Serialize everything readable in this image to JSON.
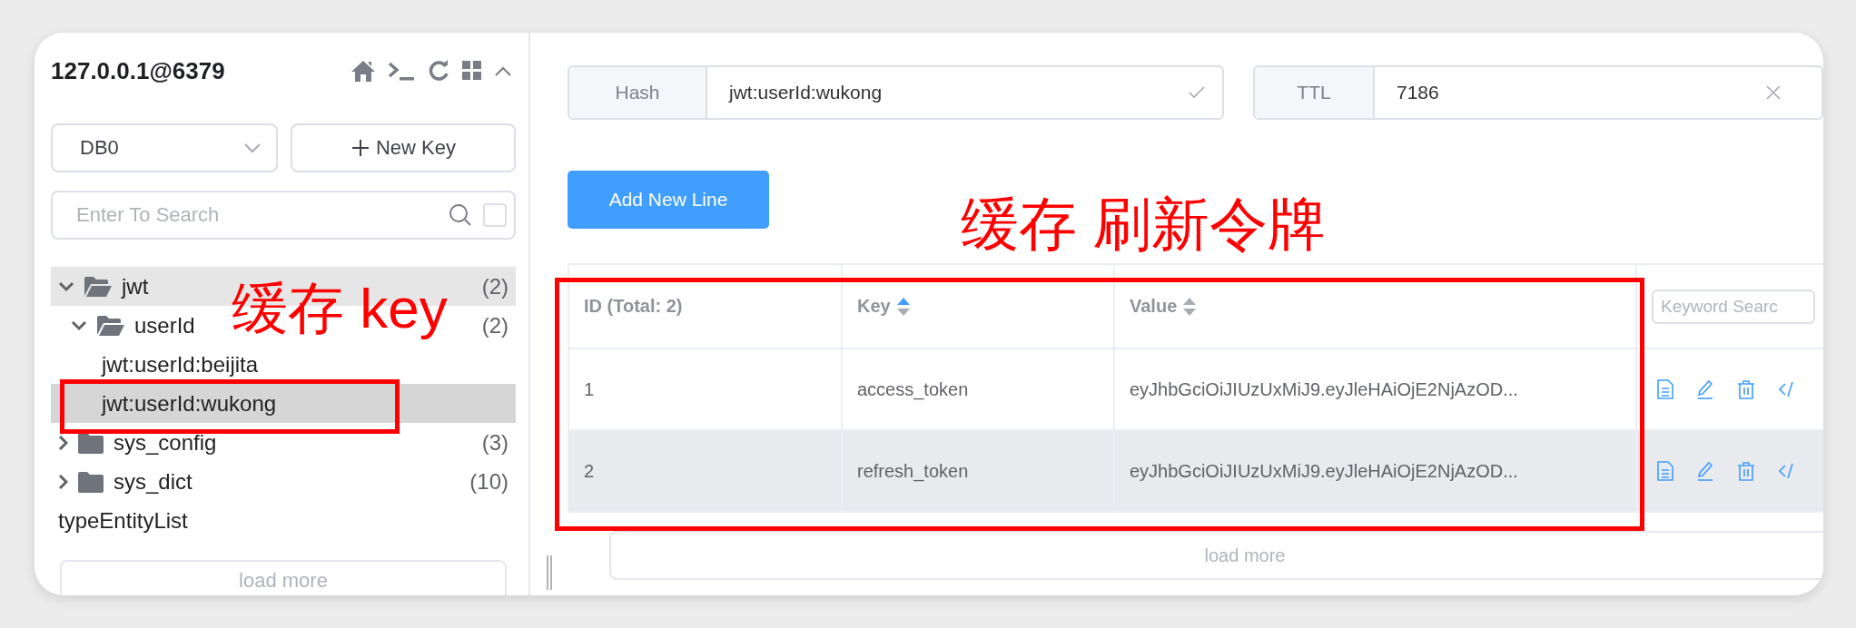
{
  "sidebar": {
    "connection": "127.0.0.1@6379",
    "db_select": {
      "value": "DB0"
    },
    "new_key_button": "New Key",
    "search": {
      "placeholder": "Enter To Search",
      "checked": false
    },
    "tree": [
      {
        "kind": "folder",
        "label": "jwt",
        "count": "(2)",
        "expanded": true,
        "highlighted": true,
        "selected": false,
        "children": [
          {
            "kind": "folder",
            "label": "userId",
            "count": "(2)",
            "expanded": true,
            "highlighted": false,
            "selected": false,
            "children": [
              {
                "kind": "key",
                "label": "jwt:userId:beijita",
                "highlighted": false,
                "selected": false
              },
              {
                "kind": "key",
                "label": "jwt:userId:wukong",
                "highlighted": false,
                "selected": true
              }
            ]
          }
        ]
      },
      {
        "kind": "folder",
        "label": "sys_config",
        "count": "(3)",
        "expanded": false,
        "highlighted": false,
        "selected": false
      },
      {
        "kind": "folder",
        "label": "sys_dict",
        "count": "(10)",
        "expanded": false,
        "highlighted": false,
        "selected": false
      },
      {
        "kind": "key",
        "label": "typeEntityList",
        "highlighted": false,
        "selected": false
      }
    ],
    "load_more": "load more"
  },
  "key_header": {
    "type": "Hash",
    "name": "jwt:userId:wukong",
    "ttl_label": "TTL",
    "ttl_value": "7186"
  },
  "add_button": "Add New Line",
  "table": {
    "columns": [
      {
        "kind": "text",
        "label": "ID (Total: 2)"
      },
      {
        "kind": "sortable",
        "label": "Key",
        "sorted": true
      },
      {
        "kind": "sortable",
        "label": "Value",
        "sorted": false
      },
      {
        "kind": "search",
        "placeholder": "Keyword Searc"
      }
    ],
    "rows": [
      {
        "id": "1",
        "key": "access_token",
        "value": "eyJhbGciOiJIUzUxMiJ9.eyJleHAiOjE2NjAzOD...",
        "highlighted": false
      },
      {
        "id": "2",
        "key": "refresh_token",
        "value": "eyJhbGciOiJIUzUxMiJ9.eyJleHAiOjE2NjAzOD...",
        "highlighted": true
      }
    ],
    "load_more": "load more"
  },
  "annotations": [
    {
      "text": "缓存 key"
    },
    {
      "text": "缓存 刷新令牌"
    }
  ]
}
